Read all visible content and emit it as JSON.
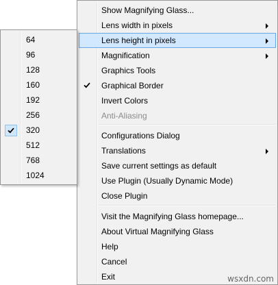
{
  "main_menu": {
    "items": [
      {
        "label": "Show Magnifying Glass...",
        "arrow": false,
        "checked": false,
        "disabled": false,
        "highlighted": false
      },
      {
        "label": "Lens width in pixels",
        "arrow": true,
        "checked": false,
        "disabled": false,
        "highlighted": false
      },
      {
        "label": "Lens height in pixels",
        "arrow": true,
        "checked": false,
        "disabled": false,
        "highlighted": true
      },
      {
        "label": "Magnification",
        "arrow": true,
        "checked": false,
        "disabled": false,
        "highlighted": false
      },
      {
        "label": "Graphics Tools",
        "arrow": false,
        "checked": false,
        "disabled": false,
        "highlighted": false
      },
      {
        "label": "Graphical Border",
        "arrow": false,
        "checked": true,
        "disabled": false,
        "highlighted": false
      },
      {
        "label": "Invert Colors",
        "arrow": false,
        "checked": false,
        "disabled": false,
        "highlighted": false
      },
      {
        "label": "Anti-Aliasing",
        "arrow": false,
        "checked": false,
        "disabled": true,
        "highlighted": false
      },
      {
        "label": "Configurations Dialog",
        "arrow": false,
        "checked": false,
        "disabled": false,
        "highlighted": false
      },
      {
        "label": "Translations",
        "arrow": true,
        "checked": false,
        "disabled": false,
        "highlighted": false
      },
      {
        "label": "Save current settings as default",
        "arrow": false,
        "checked": false,
        "disabled": false,
        "highlighted": false
      },
      {
        "label": "Use Plugin (Usually Dynamic Mode)",
        "arrow": false,
        "checked": false,
        "disabled": false,
        "highlighted": false
      },
      {
        "label": "Close Plugin",
        "arrow": false,
        "checked": false,
        "disabled": false,
        "highlighted": false
      },
      {
        "label": "Visit the Magnifying Glass homepage...",
        "arrow": false,
        "checked": false,
        "disabled": false,
        "highlighted": false
      },
      {
        "label": "About Virtual Magnifying Glass",
        "arrow": false,
        "checked": false,
        "disabled": false,
        "highlighted": false
      },
      {
        "label": "Help",
        "arrow": false,
        "checked": false,
        "disabled": false,
        "highlighted": false
      },
      {
        "label": "Cancel",
        "arrow": false,
        "checked": false,
        "disabled": false,
        "highlighted": false
      },
      {
        "label": "Exit",
        "arrow": false,
        "checked": false,
        "disabled": false,
        "highlighted": false
      }
    ]
  },
  "height_submenu": {
    "items": [
      {
        "label": "64",
        "checked": false
      },
      {
        "label": "96",
        "checked": false
      },
      {
        "label": "128",
        "checked": false
      },
      {
        "label": "160",
        "checked": false
      },
      {
        "label": "192",
        "checked": false
      },
      {
        "label": "256",
        "checked": false
      },
      {
        "label": "320",
        "checked": true
      },
      {
        "label": "512",
        "checked": false
      },
      {
        "label": "768",
        "checked": false
      },
      {
        "label": "1024",
        "checked": false
      }
    ]
  },
  "watermark": "wsxdn.com",
  "colors": {
    "menu_bg": "#f1f1f1",
    "highlight_bg": "#d1e8ff",
    "highlight_border": "#66a7e8",
    "disabled_text": "#8b8b8b"
  }
}
